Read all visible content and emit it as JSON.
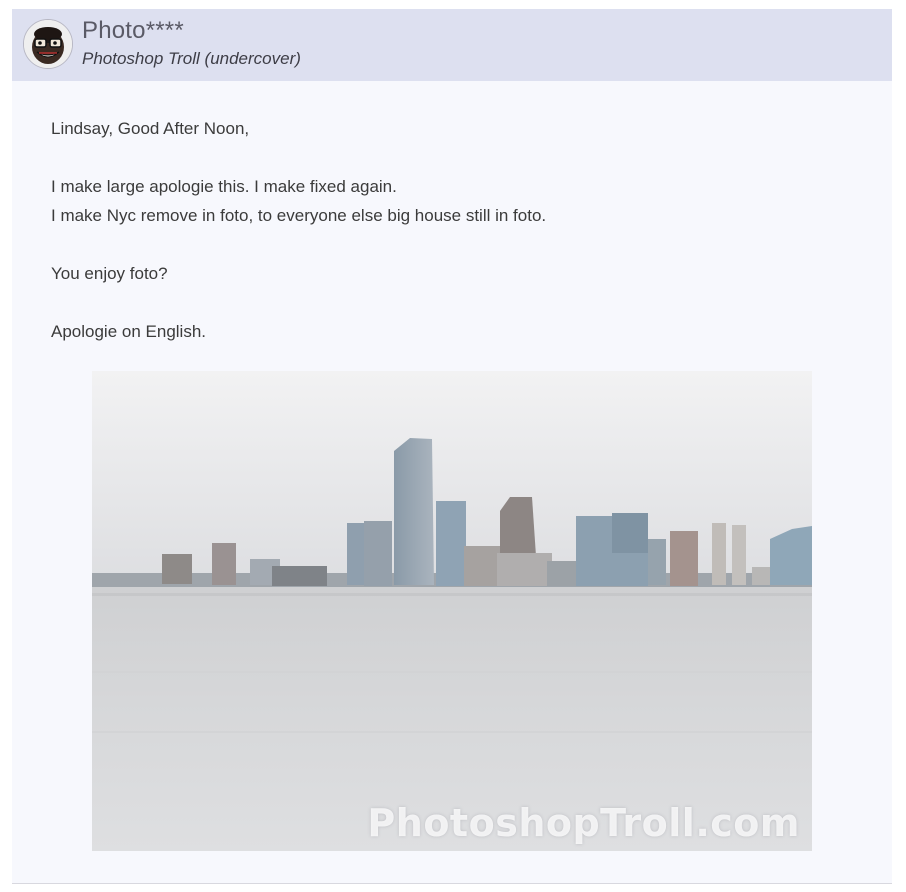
{
  "header": {
    "name": "Photo****",
    "subtitle": "Photoshop Troll (undercover)",
    "avatar_icon": "troll-face-avatar-icon"
  },
  "message": {
    "greeting": "Lindsay, Good After Noon,",
    "line1": "I make large apologie this. I make fixed again.",
    "line2": "I make Nyc remove in foto, to everyone else big house still in foto.",
    "line3": "You enjoy foto?",
    "line4": "Apologie on English."
  },
  "photo": {
    "watermark": "PhotoshopTroll.com"
  },
  "colors": {
    "header_bg": "#dde0f0",
    "card_bg": "#f7f8fd",
    "text": "#3b3b3b"
  }
}
